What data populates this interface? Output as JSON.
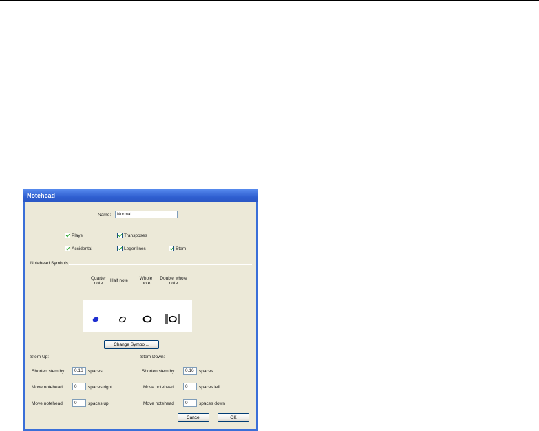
{
  "dialog": {
    "title": "Notehead",
    "name_label": "Name:",
    "name_value": "Normal",
    "checkboxes": {
      "plays": "Plays",
      "transposes": "Transposes",
      "accidental": "Accidental",
      "leger_lines": "Leger lines",
      "stem": "Stem"
    },
    "symbols_group": "Notehead Symbols",
    "symbol_headers": {
      "quarter": "Quarter note",
      "half": "Half note",
      "whole": "Whole note",
      "double_whole": "Double whole note"
    },
    "change_symbol_label": "Change Symbol...",
    "stem_up": {
      "title": "Stem Up:",
      "shorten_label": "Shorten stem by",
      "shorten_value": "0.16",
      "shorten_unit": "spaces",
      "move1_label": "Move notehead",
      "move1_value": "0",
      "move1_unit": "spaces right",
      "move2_label": "Move notehead",
      "move2_value": "0",
      "move2_unit": "spaces up"
    },
    "stem_down": {
      "title": "Stem Down:",
      "shorten_label": "Shorten stem by",
      "shorten_value": "0.16",
      "shorten_unit": "spaces",
      "move1_label": "Move notehead",
      "move1_value": "0",
      "move1_unit": "spaces left",
      "move2_label": "Move notehead",
      "move2_value": "0",
      "move2_unit": "spaces down"
    },
    "cancel_label": "Cancel",
    "ok_label": "OK"
  }
}
